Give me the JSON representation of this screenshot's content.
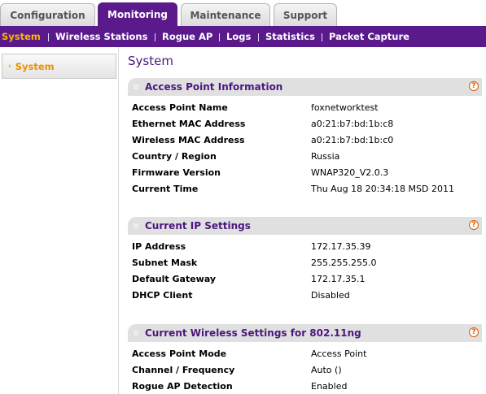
{
  "tabs": [
    "Configuration",
    "Monitoring",
    "Maintenance",
    "Support"
  ],
  "subnav": [
    "System",
    "Wireless Stations",
    "Rogue AP",
    "Logs",
    "Statistics",
    "Packet Capture"
  ],
  "sidebar": {
    "item": "System"
  },
  "page_title": "System",
  "help_glyph": "?",
  "sections": [
    {
      "title": "Access Point Information",
      "rows": [
        {
          "label": "Access Point Name",
          "value": "foxnetworktest"
        },
        {
          "label": "Ethernet MAC Address",
          "value": "a0:21:b7:bd:1b:c8"
        },
        {
          "label": "Wireless MAC Address",
          "value": "a0:21:b7:bd:1b:c0"
        },
        {
          "label": "Country / Region",
          "value": "Russia"
        },
        {
          "label": "Firmware Version",
          "value": "WNAP320_V2.0.3"
        },
        {
          "label": "Current Time",
          "value": "Thu Aug 18 20:34:18 MSD 2011"
        }
      ]
    },
    {
      "title": "Current IP Settings",
      "rows": [
        {
          "label": "IP Address",
          "value": "172.17.35.39"
        },
        {
          "label": "Subnet Mask",
          "value": "255.255.255.0"
        },
        {
          "label": "Default Gateway",
          "value": "172.17.35.1"
        },
        {
          "label": "DHCP Client",
          "value": "Disabled"
        }
      ]
    },
    {
      "title": "Current Wireless Settings for 802.11ng",
      "rows": [
        {
          "label": "Access Point Mode",
          "value": "Access Point"
        },
        {
          "label": "Channel / Frequency",
          "value": "Auto ()"
        },
        {
          "label": "Rogue AP Detection",
          "value": "Enabled"
        }
      ]
    }
  ],
  "colors": {
    "brand_purple": "#5a1a8c",
    "active_orange": "#ffb400",
    "title_purple": "#4b1780"
  }
}
